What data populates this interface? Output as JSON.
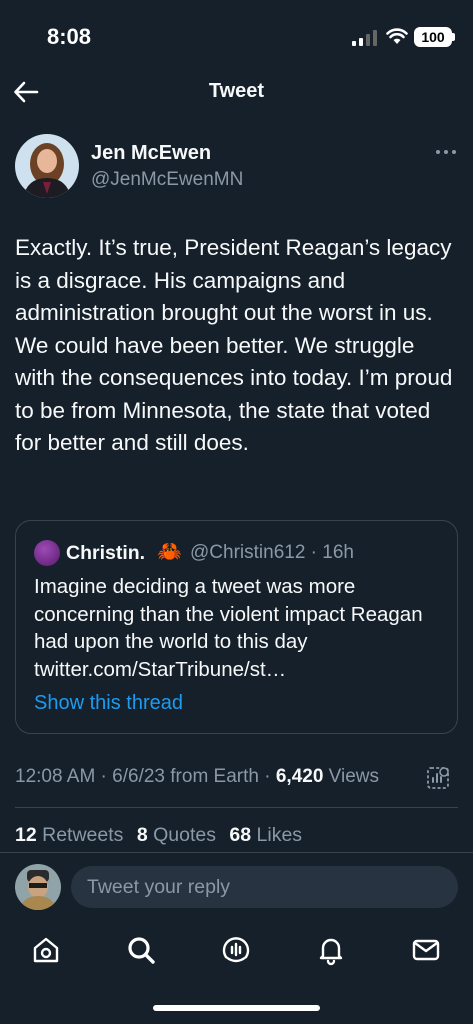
{
  "status_bar": {
    "time": "8:08",
    "battery": "100"
  },
  "header": {
    "title": "Tweet"
  },
  "tweet": {
    "author_name": "Jen McEwen",
    "author_handle": "@JenMcEwenMN",
    "text": "Exactly. It’s true, President Reagan’s legacy is a disgrace. His campaigns and administration brought out the worst in us. We could have been better. We struggle with the consequences into today. I’m proud to be from Minnesota, the state that voted for better and still does.",
    "quoted": {
      "author_name": "Christin.",
      "emoji": "🦀",
      "handle_time": "@Christin612 · 16h",
      "text": "Imagine deciding a tweet was more concerning than the violent impact Reagan had upon the world to this day twitter.com/StarTribune/st…",
      "show_thread": "Show this thread"
    },
    "meta": {
      "timestamp": "12:08 AM · 6/6/23 from Earth · ",
      "views_count": "6,420",
      "views_label": " Views"
    },
    "counts": {
      "retweets_count": "12",
      "retweets_label": " Retweets",
      "quotes_count": "8",
      "quotes_label": " Quotes",
      "likes_count": "68",
      "likes_label": " Likes"
    }
  },
  "reply": {
    "placeholder": "Tweet your reply"
  },
  "tabbar": {
    "icons": [
      "home-icon",
      "search-icon",
      "spaces-icon",
      "notifications-icon",
      "messages-icon"
    ]
  },
  "colors": {
    "background": "#15202b",
    "text": "#f7f9f9",
    "secondary": "#8b98a5",
    "accent": "#1d9bf0",
    "border": "#38444d"
  }
}
